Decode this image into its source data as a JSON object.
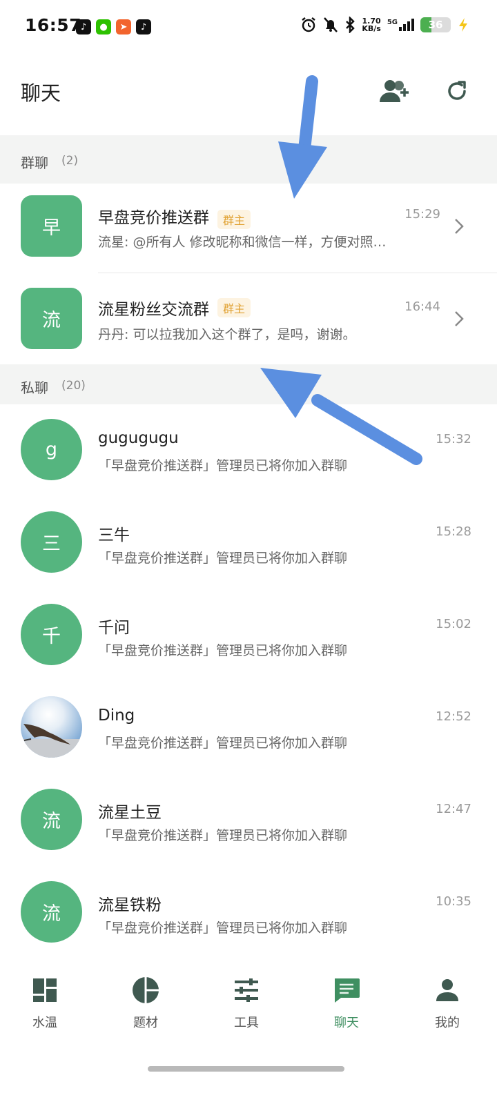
{
  "status_bar": {
    "time": "16:57",
    "net_speed_value": "1.70",
    "net_speed_unit": "KB/s",
    "network": "5G",
    "battery": "36",
    "battery_level": 0.36
  },
  "header": {
    "title": "聊天",
    "add_friend_icon": "person-add-icon",
    "refresh_icon": "refresh-icon"
  },
  "group_section": {
    "title": "群聊",
    "count": "(2)",
    "items": [
      {
        "avatar_char": "早",
        "name": "早盘竞价推送群",
        "badge": "群主",
        "time": "15:29",
        "message": "流星: @所有人  修改昵称和微信一样，方便对照…"
      },
      {
        "avatar_char": "流",
        "name": "流星粉丝交流群",
        "badge": "群主",
        "time": "16:44",
        "message": "丹丹: 可以拉我加入这个群了，是吗，谢谢。"
      }
    ]
  },
  "private_section": {
    "title": "私聊",
    "count": "(20)",
    "items": [
      {
        "avatar_char": "g",
        "name": "gugugugu",
        "time": "15:32",
        "message": "「早盘竞价推送群」管理员已将你加入群聊"
      },
      {
        "avatar_char": "三",
        "name": "三牛",
        "time": "15:28",
        "message": "「早盘竞价推送群」管理员已将你加入群聊"
      },
      {
        "avatar_char": "千",
        "name": "千问",
        "time": "15:02",
        "message": "「早盘竞价推送群」管理员已将你加入群聊"
      },
      {
        "avatar_char": "",
        "name": "Ding",
        "time": "12:52",
        "message": "「早盘竞价推送群」管理员已将你加入群聊"
      },
      {
        "avatar_char": "流",
        "name": "流星土豆",
        "time": "12:47",
        "message": "「早盘竞价推送群」管理员已将你加入群聊"
      },
      {
        "avatar_char": "流",
        "name": "流星铁粉",
        "time": "10:35",
        "message": "「早盘竞价推送群」管理员已将你加入群聊"
      }
    ]
  },
  "bottom_nav": {
    "items": [
      {
        "label": "水温",
        "icon": "dashboard-icon"
      },
      {
        "label": "题材",
        "icon": "pie-chart-icon"
      },
      {
        "label": "工具",
        "icon": "sliders-icon"
      },
      {
        "label": "聊天",
        "icon": "chat-icon",
        "active": true
      },
      {
        "label": "我的",
        "icon": "person-icon"
      }
    ]
  },
  "colors": {
    "accent_green": "#55b57f",
    "active_green": "#3f8f61",
    "owner_badge": "#e0a030",
    "arrow_blue": "#5b8fe0"
  }
}
